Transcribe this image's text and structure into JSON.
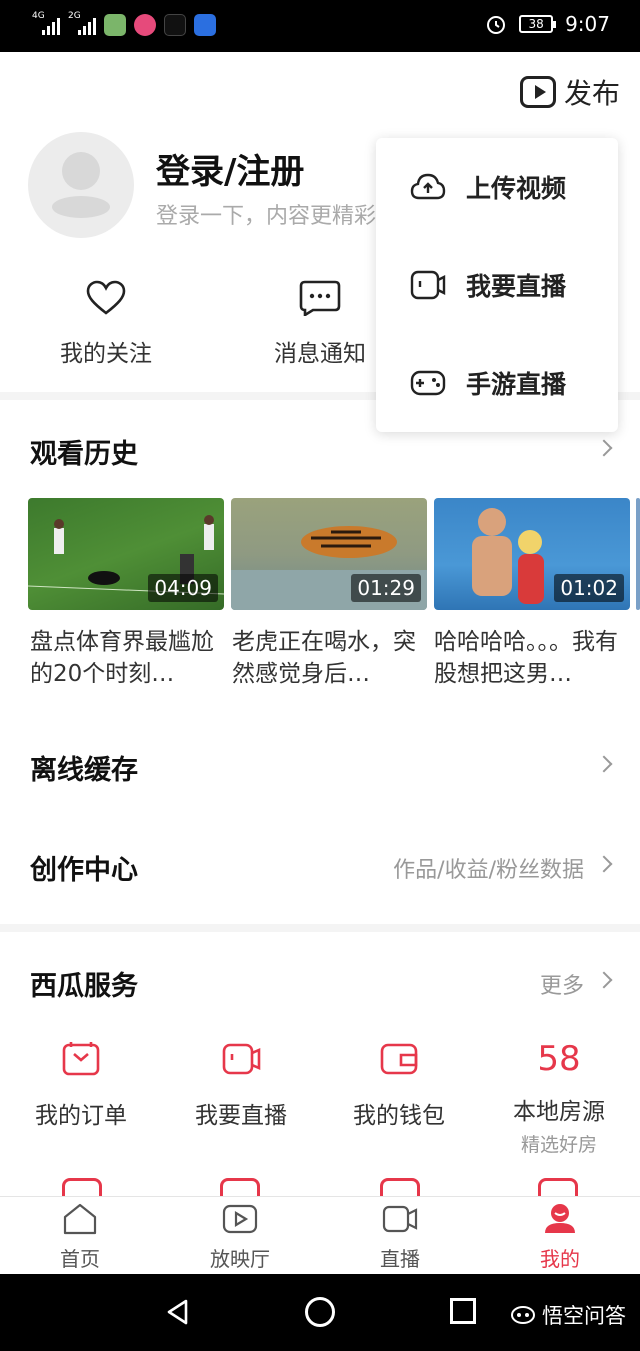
{
  "status_bar": {
    "network1": "4G",
    "network2": "2G",
    "battery": "38",
    "time": "9:07"
  },
  "header": {
    "publish_label": "发布"
  },
  "profile": {
    "title": "登录/注册",
    "subtitle": "登录一下，内容更精彩"
  },
  "quick_actions": [
    {
      "label": "我的关注",
      "icon": "heart-icon"
    },
    {
      "label": "消息通知",
      "icon": "message-icon"
    }
  ],
  "dropdown": {
    "items": [
      {
        "label": "上传视频",
        "icon": "upload-cloud-icon"
      },
      {
        "label": "我要直播",
        "icon": "camera-icon"
      },
      {
        "label": "手游直播",
        "icon": "gamepad-icon"
      }
    ]
  },
  "history": {
    "title": "观看历史",
    "videos": [
      {
        "duration": "04:09",
        "title": "盘点体育界最尴尬的20个时刻…"
      },
      {
        "duration": "01:29",
        "title": "老虎正在喝水，突然感觉身后…"
      },
      {
        "duration": "01:02",
        "title": "哈哈哈哈。。。我有股想把这男…"
      }
    ]
  },
  "offline": {
    "title": "离线缓存"
  },
  "creator": {
    "title": "创作中心",
    "right": "作品/收益/粉丝数据"
  },
  "services": {
    "title": "西瓜服务",
    "more": "更多",
    "items": [
      {
        "label": "我的订单",
        "icon": "order-icon"
      },
      {
        "label": "我要直播",
        "icon": "camera-icon"
      },
      {
        "label": "我的钱包",
        "icon": "wallet-icon"
      },
      {
        "label": "本地房源",
        "sub": "精选好房",
        "badge": "58"
      }
    ]
  },
  "tabs": [
    {
      "label": "首页",
      "icon": "home-icon"
    },
    {
      "label": "放映厅",
      "icon": "tv-icon"
    },
    {
      "label": "直播",
      "icon": "video-camera-icon"
    },
    {
      "label": "我的",
      "icon": "profile-icon",
      "active": true
    }
  ],
  "watermark": "悟空问答",
  "colors": {
    "accent": "#e6374a"
  }
}
